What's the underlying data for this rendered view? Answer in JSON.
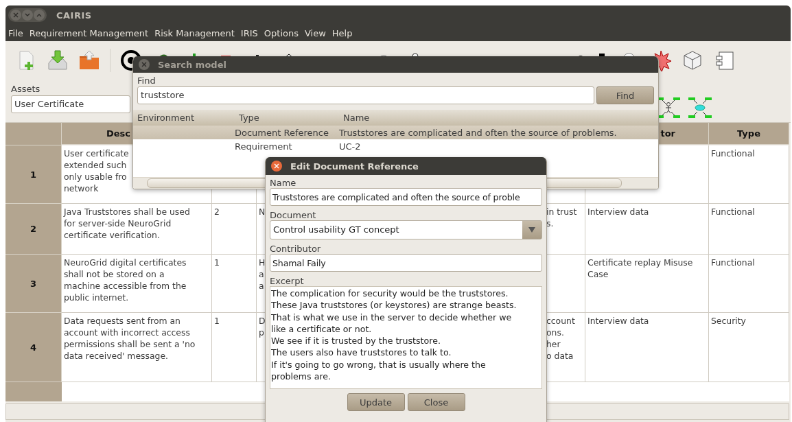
{
  "window": {
    "title": "CAIRIS"
  },
  "menu": [
    "File",
    "Requirement Management",
    "Risk Management",
    "IRIS",
    "Options",
    "View",
    "Help"
  ],
  "assets": {
    "label": "Assets",
    "value": "User Certificate"
  },
  "table": {
    "header": {
      "description": "Desc",
      "column_6": "tor",
      "type": "Type"
    },
    "rows": [
      {
        "number": "1",
        "description": [
          "User certificate",
          "extended such",
          "only usable fro",
          "network"
        ],
        "type": "Functional"
      },
      {
        "number": "2",
        "description": [
          "Java Truststores shall be used",
          "for server-side NeuroGrid",
          "certificate verification."
        ],
        "column_3": "2",
        "column_4": [
          "N"
        ],
        "column_5": [
          "in trust",
          "s."
        ],
        "column_6": "Interview data",
        "type": "Functional"
      },
      {
        "number": "3",
        "description": [
          "NeuroGrid digital certificates",
          "shall not be stored on a",
          "machine accessible from the",
          "public internet."
        ],
        "column_3": "1",
        "column_4": [
          "H",
          "a",
          "a"
        ],
        "column_6": "Certificate replay Misuse Case",
        "type": "Functional"
      },
      {
        "number": "4",
        "description": [
          "Data requests sent from an",
          "account with incorrect access",
          "permissions shall be sent a 'no",
          "data received' message."
        ],
        "column_3": "1",
        "column_4": [
          "D",
          "p"
        ],
        "column_5": [
          "ccount",
          "ons.",
          "her",
          "o data"
        ],
        "column_6": "Interview data",
        "type": "Security"
      }
    ]
  },
  "search_dialog": {
    "title": "Search model",
    "find_label": "Find",
    "query": "truststore",
    "find_button": "Find",
    "columns": [
      "Environment",
      "Type",
      "Name"
    ],
    "results": [
      {
        "type": "Document Reference",
        "name": "Truststores are complicated and often the source of problems.",
        "selected": true
      },
      {
        "type": "Requirement",
        "name": "UC-2",
        "selected": false
      }
    ]
  },
  "edit_dialog": {
    "title": "Edit Document Reference",
    "fields": [
      {
        "label": "Name",
        "kind": "text",
        "value": "Truststores are complicated and often the source of proble"
      },
      {
        "label": "Document",
        "kind": "combo",
        "value": "Control usability GT concept"
      },
      {
        "label": "Contributor",
        "kind": "text",
        "value": "Shamal Faily"
      }
    ],
    "excerpt": {
      "label": "Excerpt",
      "lines": [
        "The complication for security would be the truststores.",
        "These Java truststores (or keystores) are strange beasts.",
        "That is what we use in the server to decide whether we",
        "like a certificate or not.",
        "We see if it is trusted by the truststore.",
        "The users also have truststores to talk to.",
        "If it's going to go wrong, that is usually where the",
        "problems are."
      ]
    },
    "buttons": [
      "Update",
      "Close"
    ]
  }
}
